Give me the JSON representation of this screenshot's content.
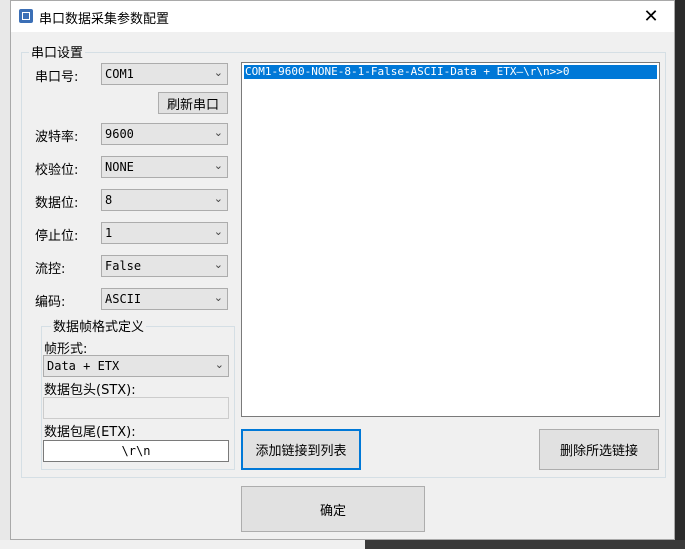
{
  "window": {
    "title": "串口数据采集参数配置",
    "close_glyph": "✕"
  },
  "serial_group": {
    "legend": "串口设置",
    "port_label": "串口号:",
    "port_value": "COM1",
    "refresh_button": "刷新串口",
    "baud_label": "波特率:",
    "baud_value": "9600",
    "parity_label": "校验位:",
    "parity_value": "NONE",
    "databits_label": "数据位:",
    "databits_value": "8",
    "stopbits_label": "停止位:",
    "stopbits_value": "1",
    "flow_label": "流控:",
    "flow_value": "False",
    "encoding_label": "编码:",
    "encoding_value": "ASCII"
  },
  "frame_group": {
    "legend": "数据帧格式定义",
    "form_label": "帧形式:",
    "form_value": "Data + ETX",
    "stx_label": "数据包头(STX):",
    "stx_value": "",
    "etx_label": "数据包尾(ETX):",
    "etx_value": "\\r\\n"
  },
  "list": {
    "items": [
      "COM1-9600-NONE-8-1-False-ASCII-Data + ETX—\\r\\n>>0"
    ]
  },
  "buttons": {
    "add_to_list": "添加链接到列表",
    "delete_selected": "删除所选链接",
    "ok": "确定"
  },
  "icons": {
    "dropdown": "chevron-down-icon",
    "app": "app-icon",
    "close": "close-icon"
  }
}
